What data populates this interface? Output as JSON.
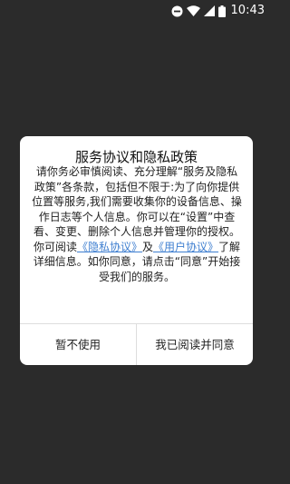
{
  "status_bar": {
    "time": "10:43",
    "icons": [
      "do-not-disturb-icon",
      "wifi-icon",
      "signal-icon",
      "battery-icon"
    ]
  },
  "dialog": {
    "title": "服务协议和隐私政策",
    "paragraph1": "请你务必审慎阅读、充分理解“服务及隐私政策”各条款，包括但不限于:为了向你提供位置等服务,我们需要收集你的设备信息、操作日志等个人信息。你可以在“设置”中查看、变更、删除个人信息并管理你的授权。",
    "p2_prefix": "你可阅读",
    "privacy_link": "《隐私协议》",
    "p2_and": "及",
    "user_link": "《用户协议》",
    "p2_suffix": "了解详细信息。如你同意，请点击“同意”开始接受我们的服务。",
    "decline_label": "暂不使用",
    "agree_label": "我已阅读并同意"
  },
  "colors": {
    "background": "#2b2b2b",
    "dialog": "#ffffff",
    "link": "#3f7fd0"
  }
}
